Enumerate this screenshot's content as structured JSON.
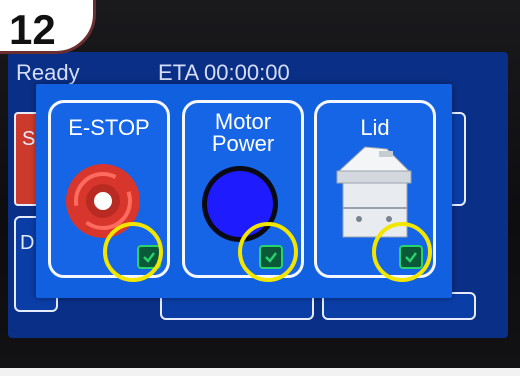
{
  "step_badge": {
    "number": "12"
  },
  "status_bar": {
    "state": "Ready",
    "eta": "ETA 00:00:00"
  },
  "background_tiles": {
    "start_letter": "S",
    "bottom_letter": "D"
  },
  "checklist": {
    "cards": [
      {
        "label": "E-STOP",
        "status": "checked",
        "icon": "emergency-stop-button-icon"
      },
      {
        "label": "Motor Power",
        "label_lines": [
          "Motor",
          "Power"
        ],
        "status": "checked",
        "icon": "blue-power-indicator-icon"
      },
      {
        "label": "Lid",
        "status": "checked",
        "icon": "machine-lid-icon"
      }
    ]
  },
  "colors": {
    "screen_bg": "#0a2f86",
    "overlay_bg": "#1160df",
    "check_green": "#27d36a",
    "highlight_yellow": "#f2e600",
    "estop_red": "#e23b32",
    "motor_blue": "#1f1bff"
  }
}
